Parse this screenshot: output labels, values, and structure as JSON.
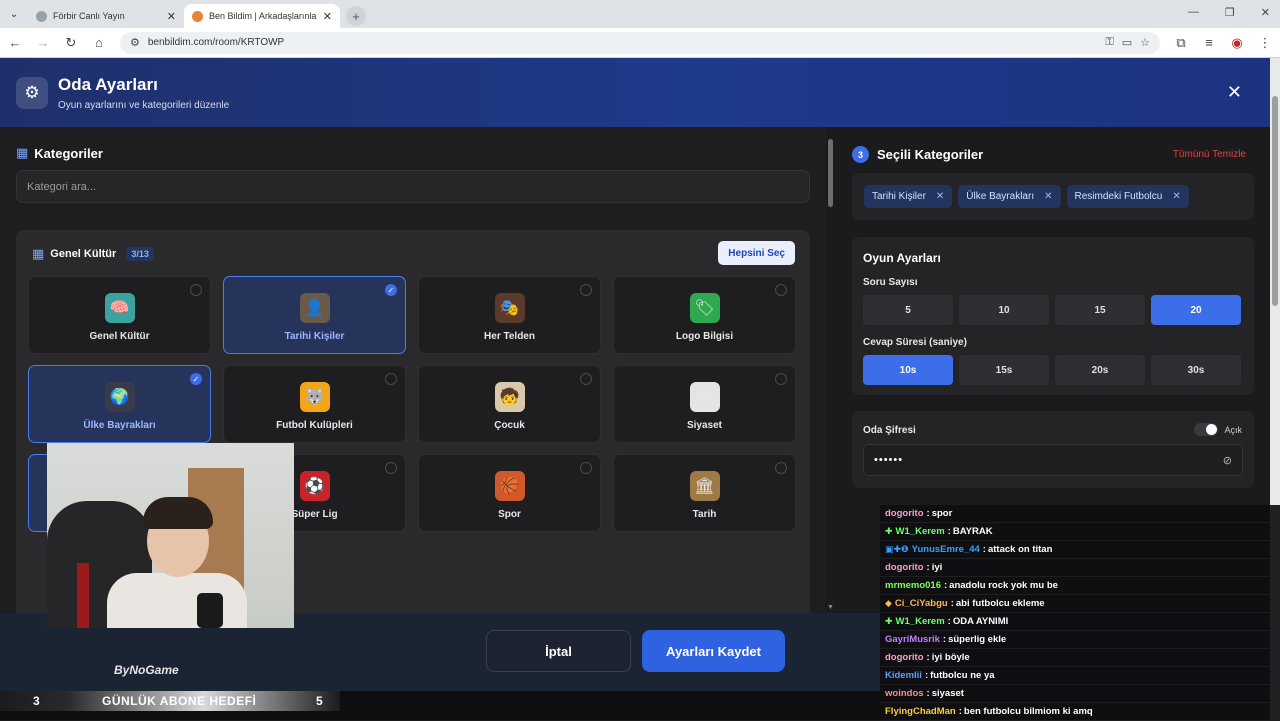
{
  "browser": {
    "tabs": [
      {
        "title": "Förbir Canlı Yayın",
        "active": false
      },
      {
        "title": "Ben Bildim | Arkadaşlarınla Onli",
        "active": true
      }
    ],
    "url": "benbildim.com/room/KRTOWP"
  },
  "modal": {
    "title": "Oda Ayarları",
    "subtitle": "Oyun ayarlarını ve kategorileri düzenle"
  },
  "categories": {
    "title": "Kategoriler",
    "search_placeholder": "Kategori ara...",
    "group": {
      "name": "Genel Kültür",
      "count": "3/13",
      "select_all": "Hepsini Seç",
      "items": [
        {
          "label": "Genel Kültür",
          "selected": false,
          "icon": "brain-icon",
          "glyph": "🧠",
          "bg": "#3aa3a0"
        },
        {
          "label": "Tarihi Kişiler",
          "selected": true,
          "icon": "portrait-icon",
          "glyph": "👤",
          "bg": "#6b5a48"
        },
        {
          "label": "Her Telden",
          "selected": false,
          "icon": "mixed-icon",
          "glyph": "🎭",
          "bg": "#5a3a2a"
        },
        {
          "label": "Logo Bilgisi",
          "selected": false,
          "icon": "logo-icon",
          "glyph": "🏷",
          "bg": "#2fa84f"
        },
        {
          "label": "Ülke Bayrakları",
          "selected": true,
          "icon": "flag-globe-icon",
          "glyph": "🌍",
          "bg": "#3a3a4a"
        },
        {
          "label": "Futbol Kulüpleri",
          "selected": false,
          "icon": "wolf-crest-icon",
          "glyph": "🐺",
          "bg": "#f2a516"
        },
        {
          "label": "Çocuk",
          "selected": false,
          "icon": "kid-icon",
          "glyph": "🧒",
          "bg": "#d9c9a8"
        },
        {
          "label": "Siyaset",
          "selected": false,
          "icon": "parliament-icon",
          "glyph": "🏛",
          "bg": "#e4e4e4"
        },
        {
          "label": "",
          "selected": true,
          "icon": "",
          "glyph": "",
          "bg": "#26335a"
        },
        {
          "label": "Süper Lig",
          "selected": false,
          "icon": "super-lig-icon",
          "glyph": "⚽",
          "bg": "#c8232c"
        },
        {
          "label": "Spor",
          "selected": false,
          "icon": "sports-balls-icon",
          "glyph": "🏀",
          "bg": "#d0582a"
        },
        {
          "label": "Tarih",
          "selected": false,
          "icon": "colosseum-icon",
          "glyph": "🏛",
          "bg": "#a07a45"
        }
      ]
    }
  },
  "selected": {
    "count": "3",
    "title": "Seçili Kategoriler",
    "clear_all": "Tümünü Temizle",
    "chips": [
      "Tarihi Kişiler",
      "Ülke Bayrakları",
      "Resimdeki Futbolcu"
    ]
  },
  "game_settings": {
    "title": "Oyun Ayarları",
    "question_count_label": "Soru Sayısı",
    "question_counts": [
      {
        "label": "5",
        "on": false
      },
      {
        "label": "10",
        "on": false
      },
      {
        "label": "15",
        "on": false
      },
      {
        "label": "20",
        "on": true
      }
    ],
    "answer_time_label": "Cevap Süresi (saniye)",
    "answer_times": [
      {
        "label": "10s",
        "on": true
      },
      {
        "label": "15s",
        "on": false
      },
      {
        "label": "20s",
        "on": false
      },
      {
        "label": "30s",
        "on": false
      }
    ]
  },
  "password": {
    "label": "Oda Şifresi",
    "toggle_label": "Açık",
    "value": "••••••"
  },
  "footer": {
    "cancel": "İptal",
    "save": "Ayarları Kaydet",
    "brand": "ByNoGame"
  },
  "stream": {
    "goal_left": "3",
    "goal_text": "GÜNLÜK ABONE HEDEFİ",
    "goal_right": "5",
    "chat": [
      {
        "user": "dogorito",
        "color": "#ff9fd0",
        "badge": "",
        "msg": "spor"
      },
      {
        "user": "W1_Kerem",
        "color": "#6cff6c",
        "badge": "✚",
        "msg": "BAYRAK"
      },
      {
        "user": "YunusEmre_44",
        "color": "#3aa0ff",
        "badge": "▣✚❶",
        "msg": "attack on titan"
      },
      {
        "user": "dogorito",
        "color": "#ff9fd0",
        "badge": "",
        "msg": "iyi"
      },
      {
        "user": "mrmemo016",
        "color": "#7cff5a",
        "badge": "",
        "msg": "anadolu rock yok mu be"
      },
      {
        "user": "Ci_CiYabgu",
        "color": "#ffb35a",
        "badge": "◆",
        "msg": "abi futbolcu ekleme"
      },
      {
        "user": "W1_Kerem",
        "color": "#6cff6c",
        "badge": "✚",
        "msg": "ODA AYNIMI"
      },
      {
        "user": "GayriMusrik",
        "color": "#c77dff",
        "badge": "",
        "msg": "süperlig ekle"
      },
      {
        "user": "dogorito",
        "color": "#ff9fd0",
        "badge": "",
        "msg": "iyi böyle"
      },
      {
        "user": "Kidemlii",
        "color": "#5aa0ff",
        "badge": "",
        "msg": "futbolcu ne ya"
      },
      {
        "user": "woindos",
        "color": "#ff8a8a",
        "badge": "",
        "msg": "siyaset"
      },
      {
        "user": "FlyingChadMan",
        "color": "#ffcf3a",
        "badge": "",
        "msg": "ben futbolcu bilmiom ki amq"
      }
    ]
  }
}
